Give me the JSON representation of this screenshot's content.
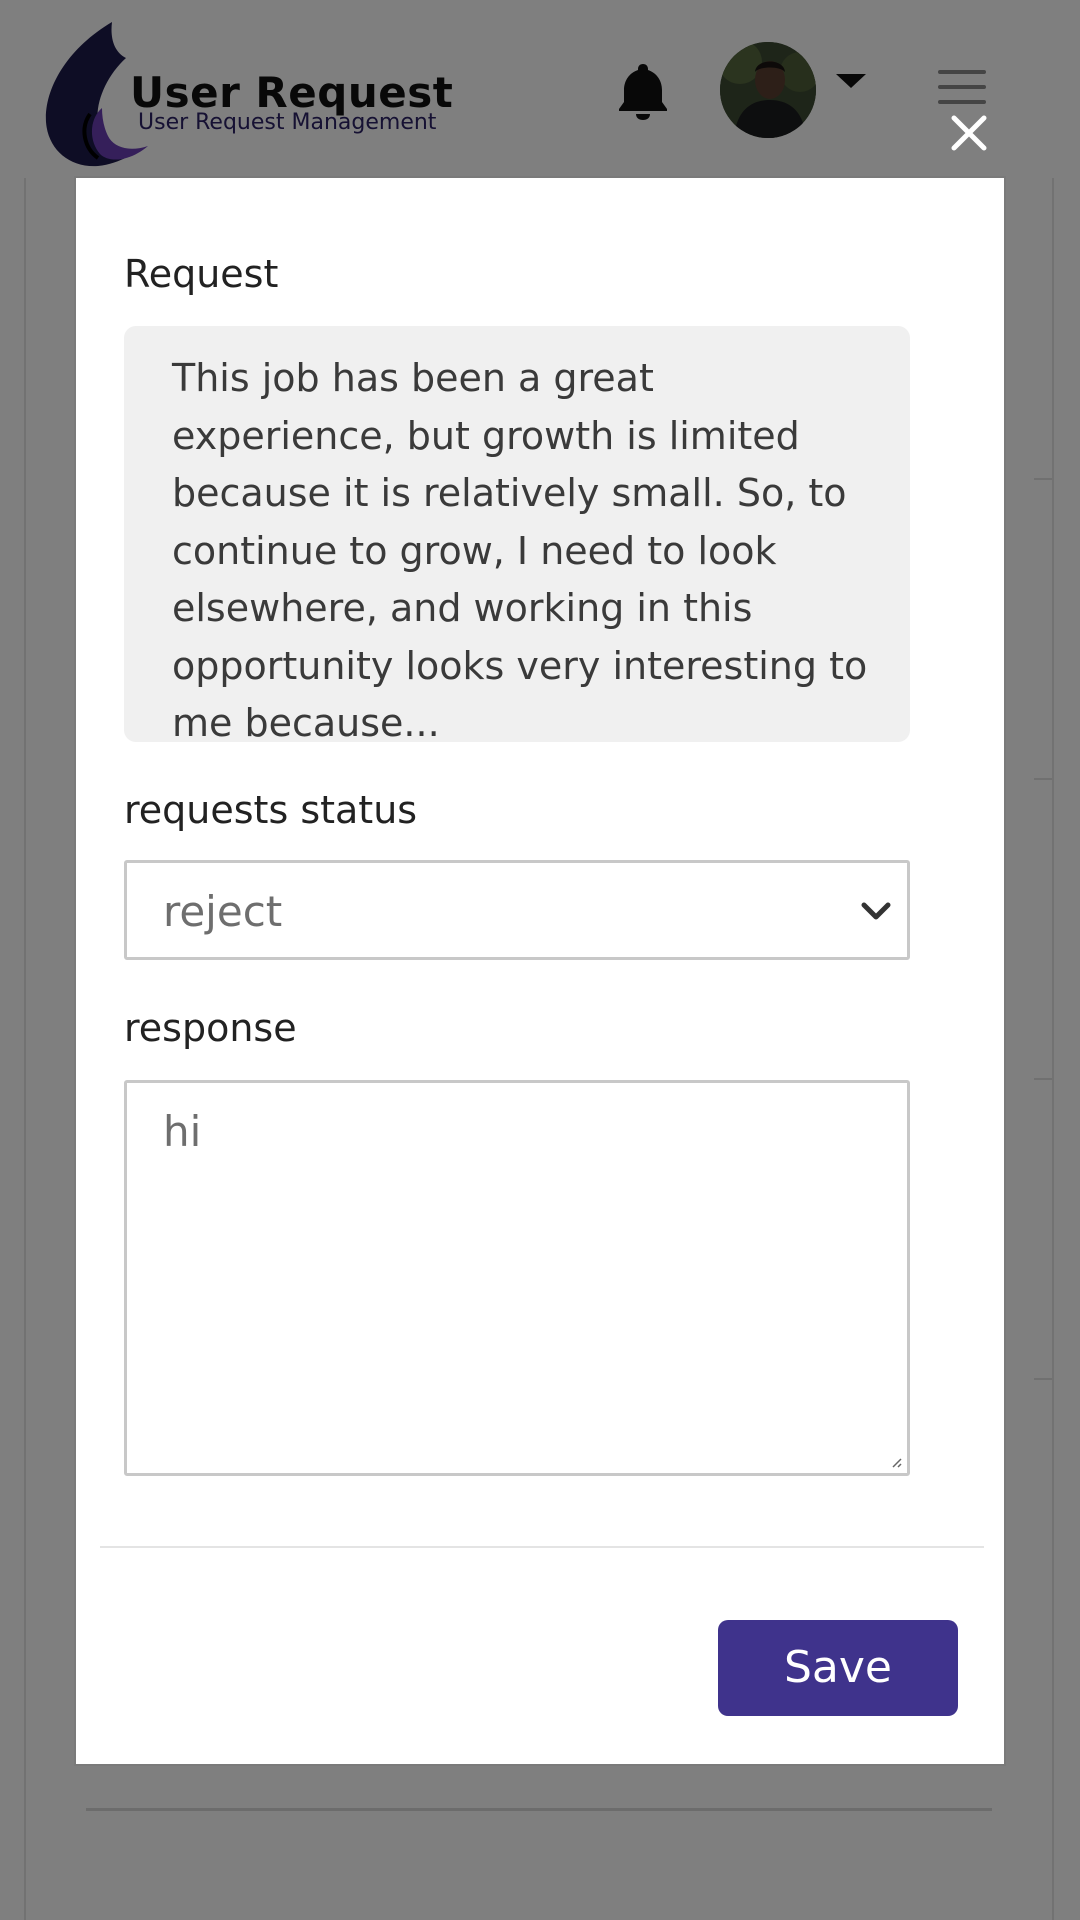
{
  "header": {
    "app_title": "User Request",
    "app_subtitle": "User Request Management",
    "icons": {
      "notifications": "bell-icon",
      "profile_menu": "caret-down-icon",
      "menu": "hamburger-icon"
    }
  },
  "modal": {
    "request_label": "Request",
    "request_text": "This job has been a great experience, but growth is limited because it is relatively small. So, to continue to grow, I need to look elsewhere, and working in this opportunity looks very interesting to me because...",
    "status_label": "requests status",
    "status_value": "reject",
    "response_label": "response",
    "response_value": "hi",
    "save_label": "Save",
    "close_icon": "close-icon"
  },
  "colors": {
    "brand_primary": "#3f338c",
    "logo_dark": "#1c1a4a",
    "overlay": "rgba(0,0,0,0.5)"
  }
}
